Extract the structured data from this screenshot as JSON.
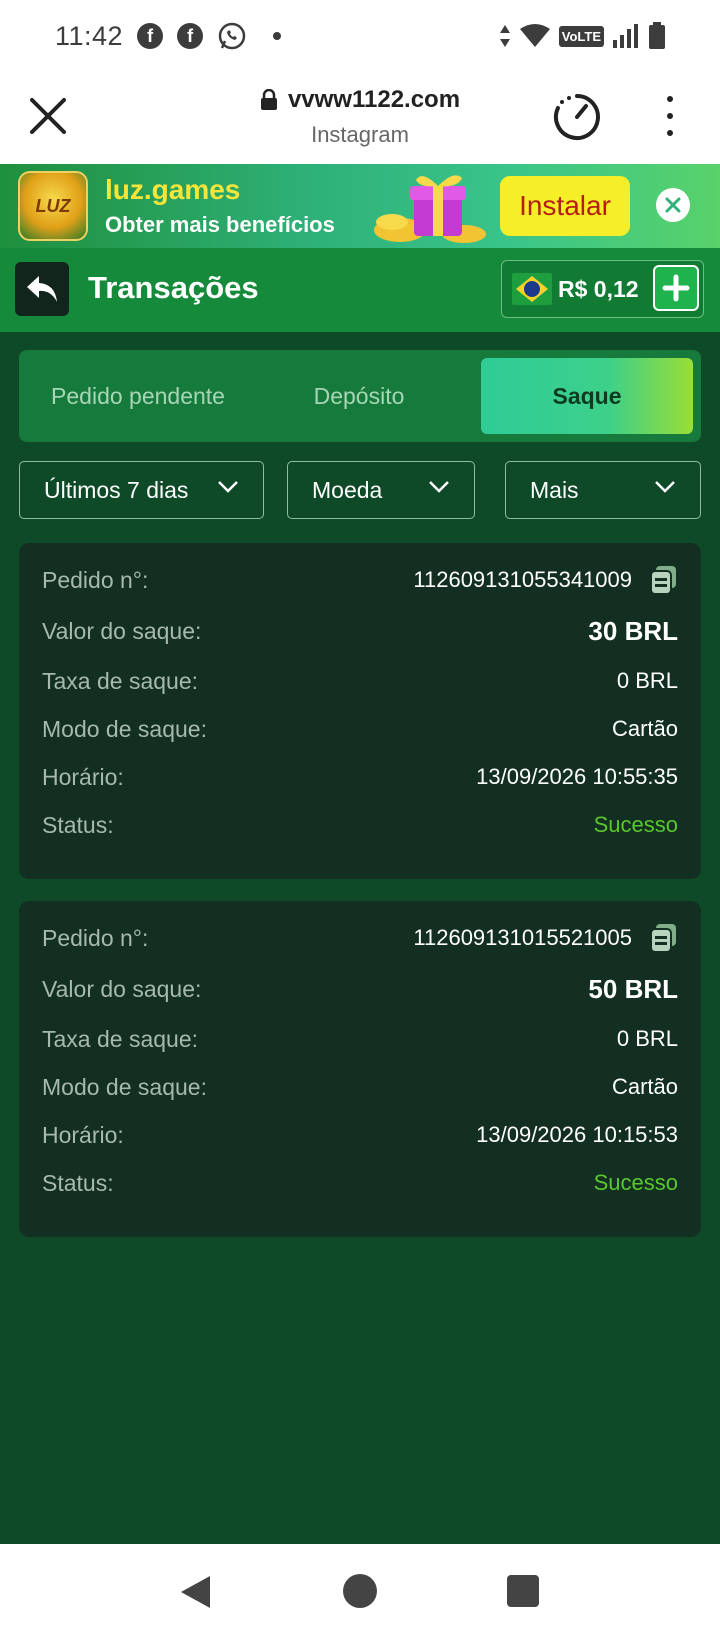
{
  "status_bar": {
    "time": "11:42",
    "volte": "VoLTE",
    "icons": [
      "facebook-icon",
      "facebook-icon",
      "whatsapp-icon",
      "notification-dot",
      "data-arrows-icon",
      "wifi-icon",
      "signal-icon",
      "battery-icon"
    ]
  },
  "browser": {
    "url": "vvww1122.com",
    "source": "Instagram"
  },
  "ad": {
    "logo_text": "LUZ",
    "title": "luz.games",
    "subtitle": "Obter mais benefícios",
    "install_label": "Instalar"
  },
  "header": {
    "title": "Transações",
    "balance": "R$ 0,12"
  },
  "tabs": [
    {
      "label": "Pedido pendente",
      "active": false
    },
    {
      "label": "Depósito",
      "active": false
    },
    {
      "label": "Saque",
      "active": true
    }
  ],
  "filters": [
    {
      "label": "Últimos 7 dias"
    },
    {
      "label": "Moeda"
    },
    {
      "label": "Mais"
    }
  ],
  "transactions": [
    {
      "order_label": "Pedido n°:",
      "order_no": "112609131055341009",
      "amount_label": "Valor do saque:",
      "amount": "30 BRL",
      "fee_label": "Taxa de saque:",
      "fee": "0 BRL",
      "mode_label": "Modo de saque:",
      "mode": "Cartão",
      "time_label": "Horário:",
      "time": "13/09/2026 10:55:35",
      "status_label": "Status:",
      "status": "Sucesso"
    },
    {
      "order_label": "Pedido n°:",
      "order_no": "112609131015521005",
      "amount_label": "Valor do saque:",
      "amount": "50 BRL",
      "fee_label": "Taxa de saque:",
      "fee": "0 BRL",
      "mode_label": "Modo de saque:",
      "mode": "Cartão",
      "time_label": "Horário:",
      "time": "13/09/2026 10:15:53",
      "status_label": "Status:",
      "status": "Sucesso"
    }
  ],
  "colors": {
    "content_bg": "#0f4a28",
    "card_bg": "#132f21",
    "success": "#59c72d",
    "header_bg": "#168a3b"
  }
}
